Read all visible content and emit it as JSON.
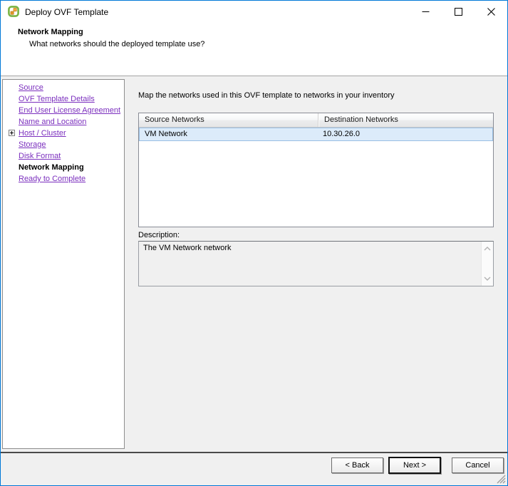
{
  "window": {
    "title": "Deploy OVF Template"
  },
  "header": {
    "title": "Network Mapping",
    "subtitle": "What networks should the deployed template use?"
  },
  "sidebar": {
    "items": [
      {
        "label": "Source",
        "state": "link"
      },
      {
        "label": "OVF Template Details",
        "state": "link"
      },
      {
        "label": "End User License Agreement",
        "state": "link"
      },
      {
        "label": "Name and Location",
        "state": "link"
      },
      {
        "label": "Host / Cluster",
        "state": "link",
        "expandable": true
      },
      {
        "label": "Storage",
        "state": "link"
      },
      {
        "label": "Disk Format",
        "state": "link"
      },
      {
        "label": "Network Mapping",
        "state": "current"
      },
      {
        "label": "Ready to Complete",
        "state": "link"
      }
    ]
  },
  "main": {
    "instruction": "Map the networks used in this OVF template to networks in your inventory",
    "table": {
      "columns": [
        "Source Networks",
        "Destination Networks"
      ],
      "rows": [
        {
          "source": "VM Network",
          "destination": "10.30.26.0",
          "selected": true
        }
      ]
    },
    "description_label": "Description:",
    "description_text": "The VM Network network"
  },
  "footer": {
    "back": "< Back",
    "next": "Next >",
    "cancel": "Cancel"
  },
  "icons": {
    "app": "vsphere-client-icon",
    "expand": "plus-box",
    "minimize": "horizontal-line",
    "maximize": "square-outline",
    "close": "x-cross",
    "scroll_up": "chevron-up",
    "scroll_down": "chevron-down",
    "resize": "diagonal-grip"
  },
  "colors": {
    "window_border": "#0078d7",
    "link": "#7b2fbe",
    "selected_row_bg": "#dcebfa",
    "selected_row_border": "#9abfe3",
    "body_bg": "#f0f0f0"
  }
}
